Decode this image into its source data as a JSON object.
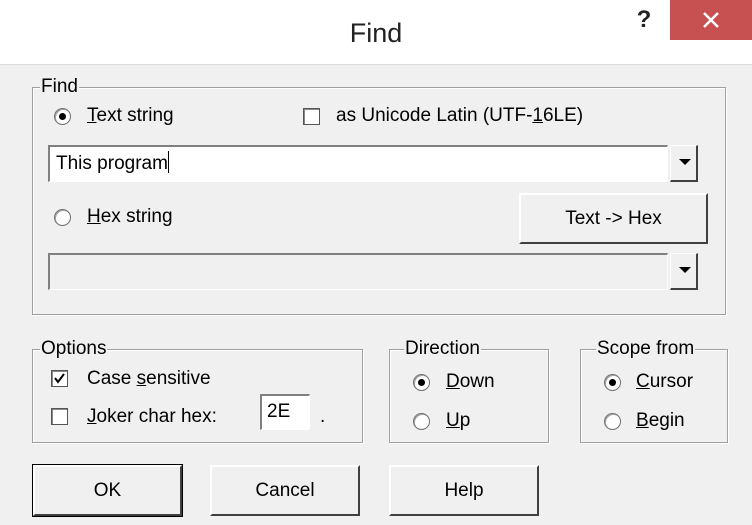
{
  "window": {
    "title": "Find",
    "help_glyph": "?",
    "close_glyph": "✕"
  },
  "find_group": {
    "legend": "Find",
    "text_string": {
      "label_prefix": "",
      "label_underline": "T",
      "label_rest": "ext string",
      "selected": true
    },
    "unicode": {
      "label_prefix": "as Unicode Latin (UTF-",
      "label_underline": "1",
      "label_rest": "6LE)",
      "checked": false
    },
    "text_value": "This program",
    "hex_string": {
      "label_prefix": "",
      "label_underline": "H",
      "label_rest": "ex string",
      "selected": false
    },
    "convert_button": "Text -> Hex",
    "hex_value": ""
  },
  "options_group": {
    "legend": "Options",
    "case_sensitive": {
      "label_prefix": "Case ",
      "label_underline": "s",
      "label_rest": "ensitive",
      "checked": true
    },
    "joker": {
      "label_prefix": "",
      "label_underline": "J",
      "label_rest": "oker char hex:",
      "checked": false
    },
    "joker_value": "2E",
    "joker_suffix": "."
  },
  "direction_group": {
    "legend": "Direction",
    "down": {
      "label_underline": "D",
      "label_rest": "own",
      "selected": true
    },
    "up": {
      "label_underline": "U",
      "label_rest": "p",
      "selected": false
    }
  },
  "scope_group": {
    "legend": "Scope from",
    "cursor": {
      "label_underline": "C",
      "label_rest": "ursor",
      "selected": true
    },
    "begin": {
      "label_underline": "B",
      "label_rest": "egin",
      "selected": false
    }
  },
  "buttons": {
    "ok": "OK",
    "cancel": "Cancel",
    "help": "Help"
  },
  "colors": {
    "close_button": "#c75050",
    "dialog_bg": "#f0f0f0"
  }
}
